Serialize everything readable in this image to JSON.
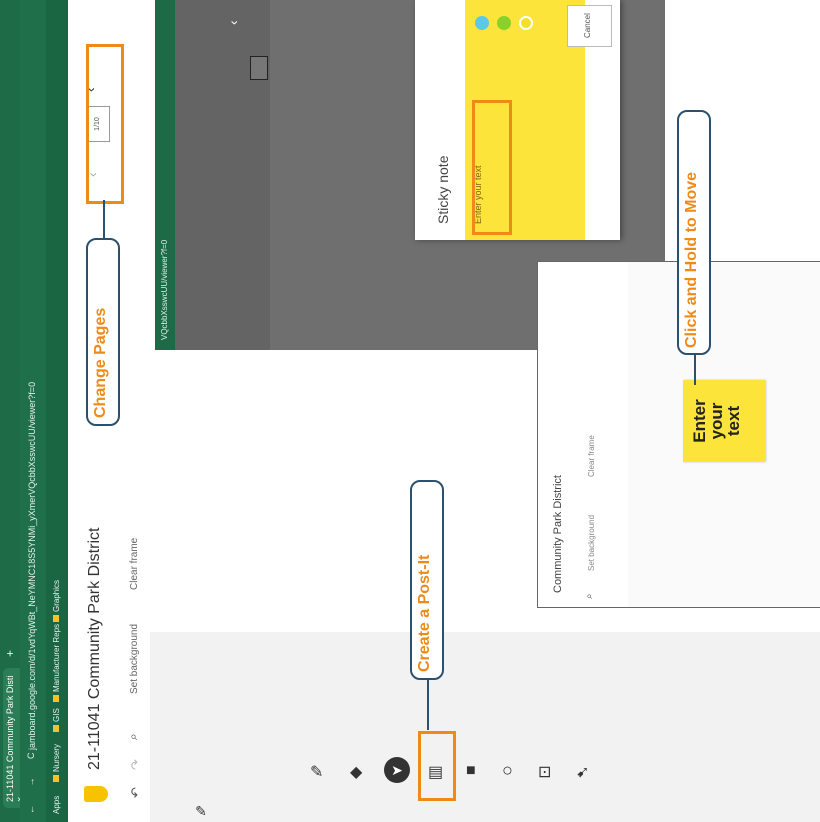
{
  "screenshot_main": {
    "tab_title": "21-11041 Community Park Disti",
    "tab_close": "×",
    "new_tab": "+",
    "nav_icons": "← → C",
    "url": "jamboard.google.com/d/1vdYqWBt_NeYMNC18S5YNMi_yXmerVQcbbXsswcUU/viewer?f=0",
    "bookmarks": [
      "Apps",
      "Nursery",
      "GIS",
      "Manufacturer Reps",
      "Graphics"
    ],
    "doc_title": "21-11041 Community Park District",
    "undo_icon": "↶",
    "redo_icon": "↷",
    "zoom_icon": "⌕",
    "set_background": "Set background",
    "clear_frame": "Clear frame",
    "frame_thumb_label": "1/10",
    "prev_icon": "‹",
    "next_icon": "‹",
    "tools": [
      {
        "name": "pen-tool",
        "glyph": "✎"
      },
      {
        "name": "eraser-tool",
        "glyph": "◆"
      },
      {
        "name": "select-tool",
        "glyph": "➤"
      },
      {
        "name": "sticky-note-tool",
        "glyph": "▤"
      },
      {
        "name": "image-tool",
        "glyph": "■"
      },
      {
        "name": "circle-tool",
        "glyph": "○"
      },
      {
        "name": "text-box-tool",
        "glyph": "⊡"
      },
      {
        "name": "laser-tool",
        "glyph": "➹"
      }
    ]
  },
  "screenshot_sticky": {
    "url_fragment": "VQcbbXsswcUU/viewer?f=0",
    "dialog_title": "Sticky note",
    "placeholder": "Enter your text",
    "colors": [
      "#5bc8e8",
      "#8bd12c",
      "#f4e125"
    ],
    "cancel": "Cancel",
    "up_icon": "‹"
  },
  "screenshot_move": {
    "doc_title": "Community Park District",
    "zoom_icon": "⌕",
    "set_background": "Set background",
    "clear_frame": "Clear frame",
    "sticky_text": "Enter your text"
  },
  "callouts": {
    "change_pages": "Change Pages",
    "create_postit": "Create a Post-It",
    "click_hold": "Click and Hold to Move"
  },
  "colors": {
    "accent": "#ee8a18",
    "outline": "#2b5170",
    "jam_green": "#1e6b47",
    "sticky_yellow": "#fde43a"
  }
}
